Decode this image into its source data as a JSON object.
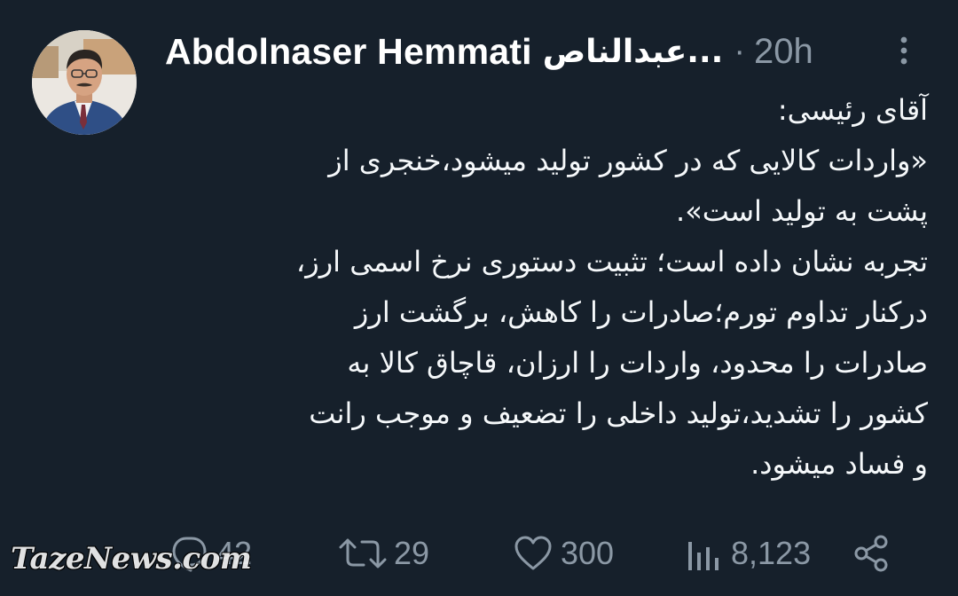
{
  "author": {
    "name": "Abdolnaser Hemmati",
    "name_fa": "عبدالناص...",
    "separator": "·",
    "time": "20h"
  },
  "tweet": {
    "lines": [
      "آقای رئیسی:",
      "«واردات کالایی که در کشور تولید میشود،خنجری از",
      "پشت به تولید است».",
      "تجربه نشان داده است؛ تثبیت دستوری نرخ اسمی ارز،",
      "درکنار تداوم تورم؛صادرات را کاهش، برگشت ارز",
      "صادرات را محدود، واردات را ارزان، قاچاق کالا به",
      "کشور را تشدید،تولید داخلی را  تضعیف و موجب رانت",
      "و فساد میشود."
    ]
  },
  "actions": {
    "replies": "42",
    "retweets": "29",
    "likes": "300",
    "views": "8,123"
  },
  "icons": {
    "more": "more-vertical-icon",
    "reply": "reply-icon",
    "retweet": "retweet-icon",
    "like": "heart-icon",
    "views": "views-icon",
    "share": "share-icon"
  },
  "watermark": "TazeNews.com",
  "colors": {
    "background": "#16202b",
    "text": "#f5f8fa",
    "muted": "#8b98a5"
  }
}
